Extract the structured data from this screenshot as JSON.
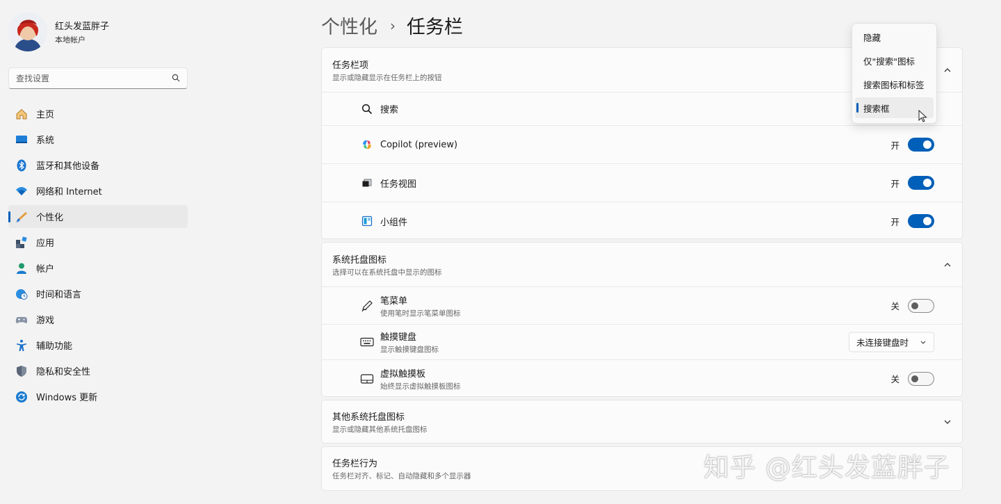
{
  "profile": {
    "name": "红头发蓝胖子",
    "account_type": "本地帐户"
  },
  "search": {
    "placeholder": "查找设置",
    "icon": "search-icon"
  },
  "nav": [
    {
      "label": "主页",
      "icon": "home-icon"
    },
    {
      "label": "系统",
      "icon": "system-icon"
    },
    {
      "label": "蓝牙和其他设备",
      "icon": "bluetooth-icon"
    },
    {
      "label": "网络和 Internet",
      "icon": "wifi-icon"
    },
    {
      "label": "个性化",
      "icon": "brush-icon",
      "selected": true
    },
    {
      "label": "应用",
      "icon": "apps-icon"
    },
    {
      "label": "帐户",
      "icon": "account-icon"
    },
    {
      "label": "时间和语言",
      "icon": "globe-clock-icon"
    },
    {
      "label": "游戏",
      "icon": "gamepad-icon"
    },
    {
      "label": "辅助功能",
      "icon": "accessibility-icon"
    },
    {
      "label": "隐私和安全性",
      "icon": "shield-icon"
    },
    {
      "label": "Windows 更新",
      "icon": "update-icon"
    }
  ],
  "breadcrumb": {
    "parent": "个性化",
    "separator": "›",
    "current": "任务栏"
  },
  "taskbar_items": {
    "title": "任务栏项",
    "subtitle": "显示或隐藏显示在任务栏上的按钮",
    "search": {
      "label": "搜索"
    },
    "copilot": {
      "label": "Copilot (preview)",
      "state": "开"
    },
    "task_view": {
      "label": "任务视图",
      "state": "开"
    },
    "widgets": {
      "label": "小组件",
      "state": "开"
    }
  },
  "tray_icons": {
    "title": "系统托盘图标",
    "subtitle": "选择可以在系统托盘中显示的图标",
    "pen": {
      "label": "笔菜单",
      "desc": "使用笔时显示笔菜单图标",
      "state": "关"
    },
    "keyboard": {
      "label": "触摸键盘",
      "desc": "显示触摸键盘图标",
      "value": "未连接键盘时"
    },
    "touchpad": {
      "label": "虚拟触摸板",
      "desc": "始终显示虚拟触摸板图标",
      "state": "关"
    }
  },
  "other_tray": {
    "title": "其他系统托盘图标",
    "subtitle": "显示或隐藏其他系统托盘图标"
  },
  "behaviors": {
    "title": "任务栏行为",
    "subtitle": "任务栏对齐、标记、自动隐藏和多个显示器"
  },
  "search_dropdown": {
    "options": [
      "隐藏",
      "仅\"搜索\"图标",
      "搜索图标和标签",
      "搜索框"
    ],
    "selected": "搜索框"
  },
  "watermark": "知乎 @红头发蓝胖子",
  "colors": {
    "accent": "#005fb8",
    "background": "#f3f3f3",
    "card": "#fbfbfb"
  }
}
